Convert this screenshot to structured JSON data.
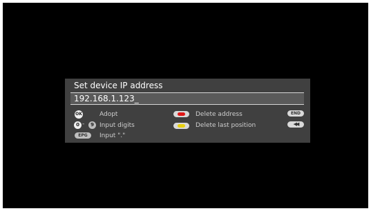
{
  "dialog": {
    "title": "Set device IP address",
    "ip_value": "192.168.1.123",
    "cursor": "_"
  },
  "hints": {
    "ok_key": "OK",
    "ok_label": "Adopt",
    "digit_start": "0",
    "digit_sep": "-",
    "digit_end": "9",
    "digits_label": "Input digits",
    "epg_key": "EPG",
    "epg_label": "Input \".\"",
    "red_label": "Delete address",
    "yellow_label": "Delete last position",
    "end_key": "END",
    "rewind_key": "◀◀"
  },
  "colors": {
    "screen_bg": "#000000",
    "dialog_bg": "#404040",
    "red_button": "#e01818",
    "yellow_button": "#e8d010"
  }
}
